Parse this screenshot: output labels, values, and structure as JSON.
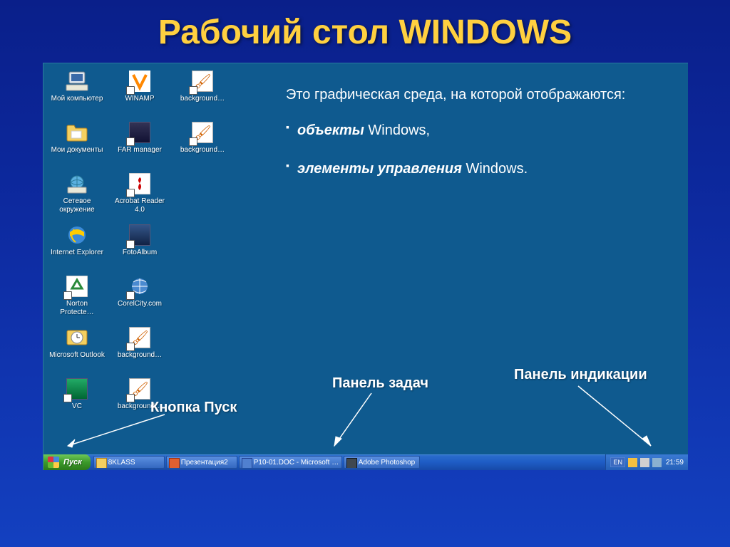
{
  "title": "Рабочий стол WINDOWS",
  "info": {
    "intro": "Это графическая среда, на которой отображаются:",
    "b1a": "объекты",
    "b1b": " Windows,",
    "b2a": "элементы управления",
    "b2b": " Windows."
  },
  "annotations": {
    "start": "Кнопка Пуск",
    "taskbar": "Панель задач",
    "tray": "Панель индикации"
  },
  "icons": {
    "r0c0": "Мой компьютер",
    "r0c1": "WINAMP",
    "r0c2": "background…",
    "r1c0": "Мои документы",
    "r1c1": "FAR manager",
    "r1c2": "background…",
    "r2c0": "Сетевое окружение",
    "r2c1": "Acrobat Reader 4.0",
    "r3c0": "Internet Explorer",
    "r3c1": "FotoAlbum",
    "r4c0": "Norton Protecte…",
    "r4c1": "CorelCity.com",
    "r5c0": "Microsoft Outlook",
    "r5c1": "background…",
    "r6c0": "VC",
    "r6c1": "background…"
  },
  "taskbar": {
    "start": "Пуск",
    "items": [
      "8KLASS",
      "Презентация2",
      "P10-01.DOC - Microsoft …",
      "Adobe Photoshop"
    ],
    "lang": "EN",
    "clock": "21:59"
  }
}
